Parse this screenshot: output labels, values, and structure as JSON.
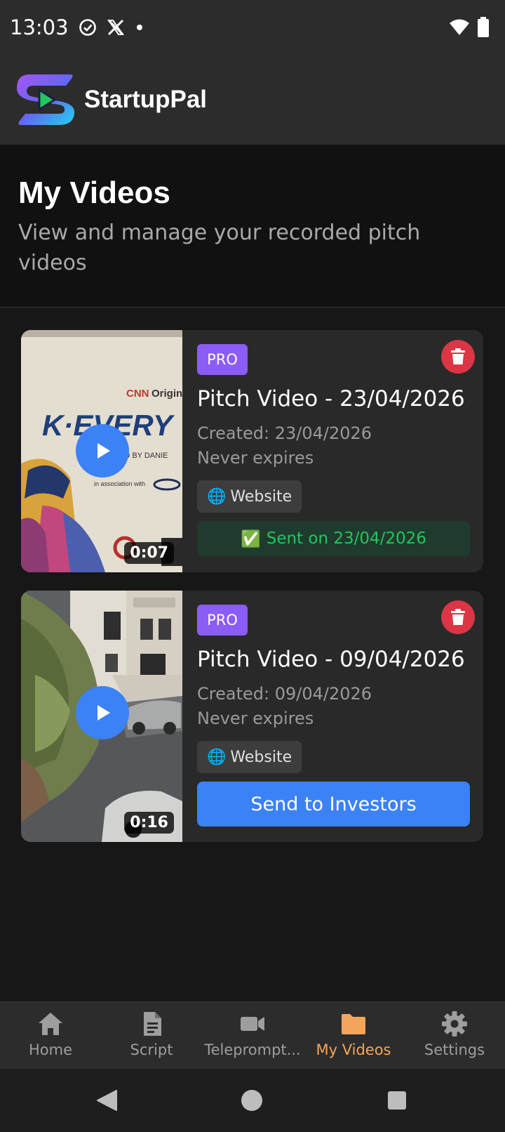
{
  "status_bar": {
    "time": "13:03",
    "icons_left": [
      "check-circle-icon",
      "x-logo-icon",
      "dot-icon"
    ],
    "icons_right": [
      "wifi-icon",
      "battery-icon"
    ]
  },
  "header": {
    "app_name": "StartupPal",
    "logo_icon": "startuppal-logo-icon"
  },
  "page": {
    "title": "My Videos",
    "subtitle": "View and manage your recorded pitch videos"
  },
  "videos": [
    {
      "badge": "PRO",
      "title": "Pitch Video - 23/04/2026",
      "created": "Created: 23/04/2026",
      "expires": "Never expires",
      "source_icon": "🌐",
      "source": "Website",
      "duration": "0:07",
      "status_icon": "✅",
      "status": "Sent on 23/04/2026"
    },
    {
      "badge": "PRO",
      "title": "Pitch Video - 09/04/2026",
      "created": "Created: 09/04/2026",
      "expires": "Never expires",
      "source_icon": "🌐",
      "source": "Website",
      "duration": "0:16",
      "action_label": "Send to Investors"
    }
  ],
  "bottom_nav": {
    "items": [
      {
        "label": "Home",
        "icon": "home-icon"
      },
      {
        "label": "Script",
        "icon": "document-icon"
      },
      {
        "label": "Teleprompt...",
        "icon": "video-camera-icon"
      },
      {
        "label": "My Videos",
        "icon": "folder-icon",
        "active": true
      },
      {
        "label": "Settings",
        "icon": "gear-icon"
      }
    ]
  },
  "colors": {
    "accent": "#3b82f6",
    "pro_badge": "#8b5cf6",
    "delete": "#dc3545",
    "sent_text": "#22c55e",
    "nav_active": "#f5a55b"
  }
}
